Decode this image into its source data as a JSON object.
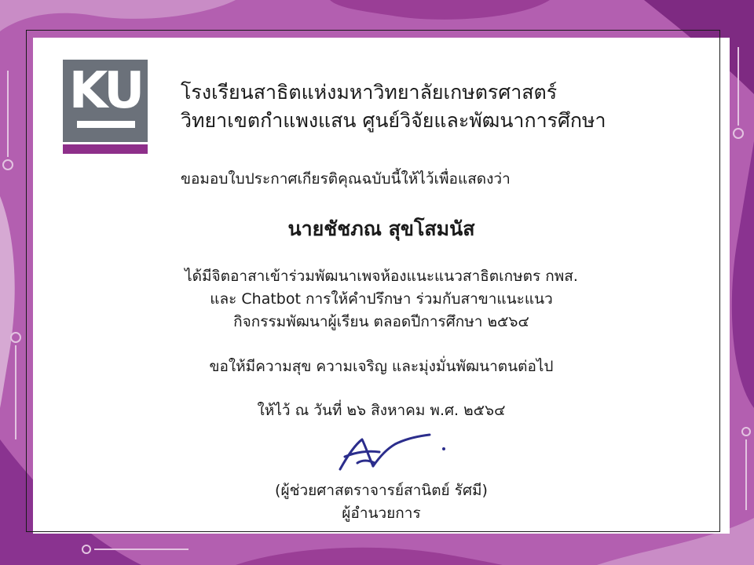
{
  "logo": {
    "letters": "KU"
  },
  "header": {
    "school_line1": "โรงเรียนสาธิตแห่งมหาวิทยาลัยเกษตรศาสตร์",
    "school_line2": "วิทยาเขตกำแพงแสน ศูนย์วิจัยและพัฒนาการศึกษา"
  },
  "certificate": {
    "intro": "ขอมอบใบประกาศเกียรติคุณฉบับนี้ให้ไว้เพื่อแสดงว่า",
    "recipient": "นายชัชภณ สุขโสมนัส",
    "body_line1": "ได้มีจิตอาสาเข้าร่วมพัฒนาเพจห้องแนะแนวสาธิตเกษตร กพส.",
    "body_line2": "และ Chatbot การให้คำปรึกษา ร่วมกับสาขาแนะแนว",
    "body_line3": "กิจกรรมพัฒนาผู้เรียน ตลอดปีการศึกษา ๒๕๖๔",
    "wish": "ขอให้มีความสุข ความเจริญ และมุ่งมั่นพัฒนาตนต่อไป",
    "date": "ให้ไว้ ณ วันที่  ๒๖ สิงหาคม  พ.ศ.  ๒๕๖๔",
    "signer_name": "(ผู้ช่วยศาสตราจารย์สานิตย์  รัศมี)",
    "signer_title": "ผู้อำนวยการ"
  },
  "colors": {
    "background": "#b35fb0",
    "accent_purple": "#8e2f8a",
    "logo_gray": "#6b717a",
    "ink_blue": "#2b2d8c"
  }
}
